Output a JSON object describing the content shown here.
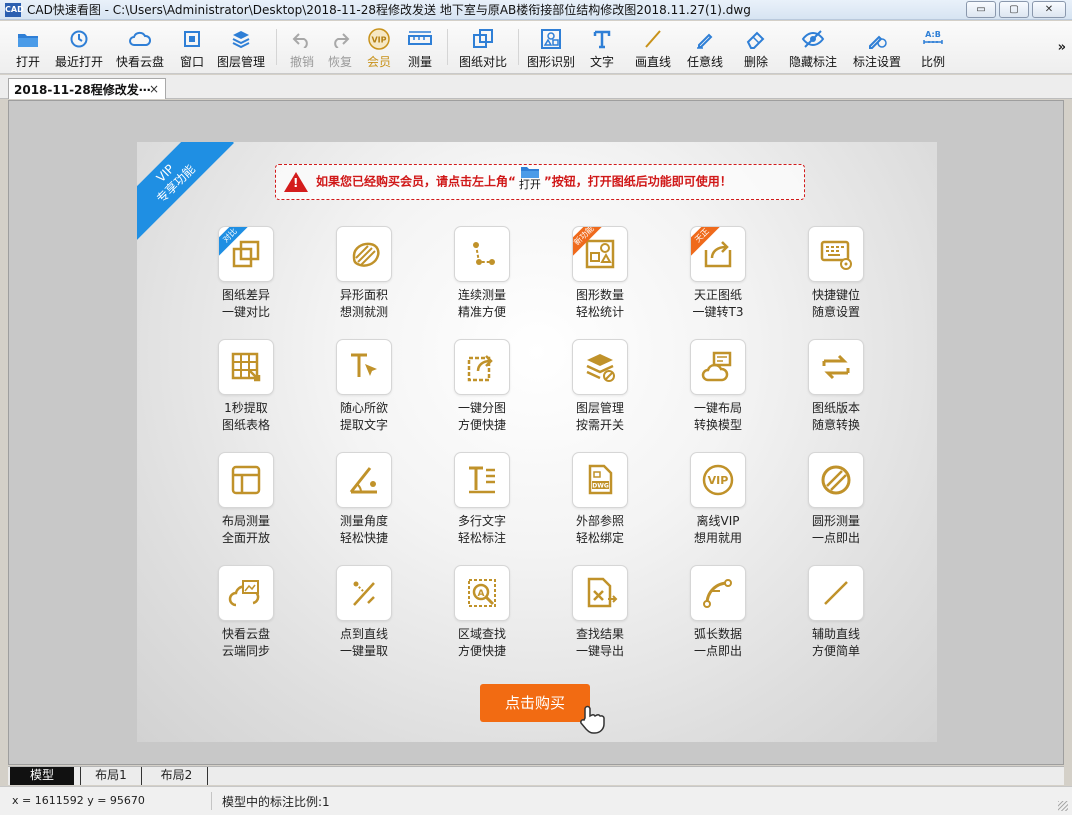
{
  "window": {
    "title": "CAD快速看图 - C:\\Users\\Administrator\\Desktop\\2018-11-28程修改发送  地下室与原AB楼衔接部位结构修改图2018.11.27(1).dwg",
    "app_icon_text": "CAD",
    "minimize": "▭",
    "maximize": "▢",
    "close": "✕"
  },
  "toolbar": {
    "items": [
      {
        "label": "打开",
        "icon": "folder-icon"
      },
      {
        "label": "最近打开",
        "icon": "clock-icon"
      },
      {
        "label": "快看云盘",
        "icon": "cloud-icon"
      },
      {
        "label": "窗口",
        "icon": "window-icon"
      },
      {
        "label": "图层管理",
        "icon": "layers-icon"
      },
      {
        "label": "撤销",
        "icon": "undo-icon"
      },
      {
        "label": "恢复",
        "icon": "redo-icon"
      },
      {
        "label": "会员",
        "icon": "vip-icon"
      },
      {
        "label": "测量",
        "icon": "ruler-icon"
      },
      {
        "label": "图纸对比",
        "icon": "compare-icon"
      },
      {
        "label": "图形识别",
        "icon": "shape-recognition-icon"
      },
      {
        "label": "文字",
        "icon": "text-icon"
      },
      {
        "label": "画直线",
        "icon": "line-icon"
      },
      {
        "label": "任意线",
        "icon": "pen-icon"
      },
      {
        "label": "删除",
        "icon": "eraser-icon"
      },
      {
        "label": "隐藏标注",
        "icon": "eye-hidden-icon"
      },
      {
        "label": "标注设置",
        "icon": "annotation-settings-icon"
      },
      {
        "label": "比例",
        "icon": "scale-icon"
      }
    ],
    "more": "»"
  },
  "tabs": {
    "document": "2018-11-28程修改发⋯",
    "close": "×"
  },
  "vip_panel": {
    "ribbon_line1": "VIP",
    "ribbon_line2": "专享功能",
    "notice_prefix": "如果您已经购买会员，请点击左上角“",
    "notice_open_label": "打开",
    "notice_suffix": "”按钮，打开图纸后功能即可使用！",
    "features": [
      {
        "line1": "图纸差异",
        "line2": "一键对比",
        "icon": "compare-icon",
        "badge": "对比",
        "badge_color": "blue"
      },
      {
        "line1": "异形面积",
        "line2": "想测就测",
        "icon": "irregular-area-icon"
      },
      {
        "line1": "连续测量",
        "line2": "精准方便",
        "icon": "continuous-measure-icon"
      },
      {
        "line1": "图形数量",
        "line2": "轻松统计",
        "icon": "shape-count-icon",
        "badge": "新功能",
        "badge_color": "orange"
      },
      {
        "line1": "天正图纸",
        "line2": "一键转T3",
        "icon": "export-icon",
        "badge": "天正",
        "badge_color": "orange"
      },
      {
        "line1": "快捷键位",
        "line2": "随意设置",
        "icon": "keyboard-settings-icon"
      },
      {
        "line1": "1秒提取",
        "line2": "图纸表格",
        "icon": "table-extract-icon"
      },
      {
        "line1": "随心所欲",
        "line2": "提取文字",
        "icon": "text-extract-icon"
      },
      {
        "line1": "一键分图",
        "line2": "方便快捷",
        "icon": "split-drawing-icon"
      },
      {
        "line1": "图层管理",
        "line2": "按需开关",
        "icon": "layers-toggle-icon"
      },
      {
        "line1": "一键布局",
        "line2": "转换模型",
        "icon": "layout-convert-icon"
      },
      {
        "line1": "图纸版本",
        "line2": "随意转换",
        "icon": "version-convert-icon"
      },
      {
        "line1": "布局测量",
        "line2": "全面开放",
        "icon": "layout-measure-icon"
      },
      {
        "line1": "测量角度",
        "line2": "轻松快捷",
        "icon": "angle-icon"
      },
      {
        "line1": "多行文字",
        "line2": "轻松标注",
        "icon": "multiline-text-icon"
      },
      {
        "line1": "外部参照",
        "line2": "轻松绑定",
        "icon": "dwg-xref-icon"
      },
      {
        "line1": "离线VIP",
        "line2": "想用就用",
        "icon": "offline-vip-icon"
      },
      {
        "line1": "圆形测量",
        "line2": "一点即出",
        "icon": "circle-measure-icon"
      },
      {
        "line1": "快看云盘",
        "line2": "云端同步",
        "icon": "cloud-sync-icon"
      },
      {
        "line1": "点到直线",
        "line2": "一键量取",
        "icon": "point-to-line-icon"
      },
      {
        "line1": "区域查找",
        "line2": "方便快捷",
        "icon": "area-search-icon"
      },
      {
        "line1": "查找结果",
        "line2": "一键导出",
        "icon": "export-results-icon"
      },
      {
        "line1": "弧长数据",
        "line2": "一点即出",
        "icon": "arc-length-icon"
      },
      {
        "line1": "辅助直线",
        "line2": "方便简单",
        "icon": "aux-line-icon"
      }
    ],
    "buy_button": "点击购买"
  },
  "layout_tabs": [
    "模型",
    "布局1",
    "布局2"
  ],
  "status": {
    "coords": "x = 1611592  y = 95670",
    "scale": "模型中的标注比例:1"
  },
  "colors": {
    "accent_gold": "#c8921a",
    "vip_blue": "#1f8fe3",
    "buy_orange": "#f26b12",
    "warn_red": "#d01818"
  }
}
